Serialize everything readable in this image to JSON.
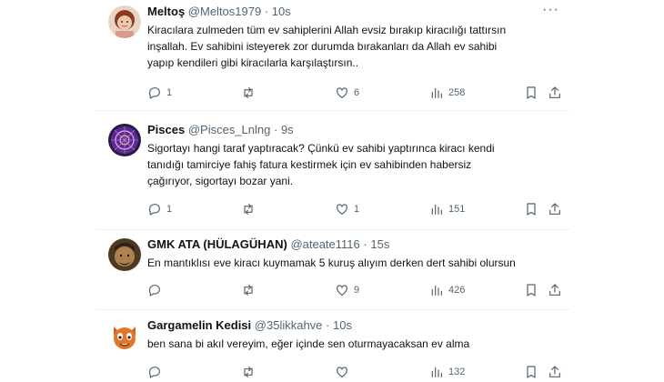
{
  "tweets": [
    {
      "name": "Meltoş",
      "handle": "@Meltos1979",
      "sep": "·",
      "time": "10s",
      "text": "Kiracılara zulmeden tüm ev sahiplerini Allah evsiz bırakıp kiracılığı tattırsın\ninşallah. Ev sahibini isteyerek zor durumda bırakanları da Allah ev sahibi\nyapıp kendileri gibi kiracılarla karşılaştırsın..",
      "replies": "1",
      "retweets": "",
      "likes": "6",
      "views": "258"
    },
    {
      "name": "Pisces",
      "handle": "@Pisces_Lnlng",
      "sep": "·",
      "time": "9s",
      "text": "Sigortayı hangi taraf yaptıracak? Çünkü ev sahibi yaptırınca kiracı kendi\ntanıdığı tamirciye fahiş fatura kestirmek için ev sahibinden habersiz\nçağırıyor, sigortayı bozar yani.",
      "replies": "1",
      "retweets": "",
      "likes": "1",
      "views": "151"
    },
    {
      "name": "GMK ATA (HÜLAGÜHAN)",
      "handle": "@ateate1116",
      "sep": "·",
      "time": "15s",
      "text": "En mantıklısı eve kiracı kuymamak 5 kuruş alıyım derken dert sahibi olursun",
      "replies": "",
      "retweets": "",
      "likes": "9",
      "views": "426"
    },
    {
      "name": "Gargamelin Kedisi",
      "handle": "@35likkahve",
      "sep": "·",
      "time": "10s",
      "text": "ben sana bi akıl vereyim, eğer içinde sen oturmayacaksan ev alma",
      "replies": "",
      "retweets": "",
      "likes": "",
      "views": "132"
    }
  ],
  "more_glyph": "···",
  "icons": [
    "reply-icon",
    "retweet-icon",
    "like-icon",
    "views-icon",
    "bookmark-icon",
    "share-icon",
    "more-icon"
  ]
}
